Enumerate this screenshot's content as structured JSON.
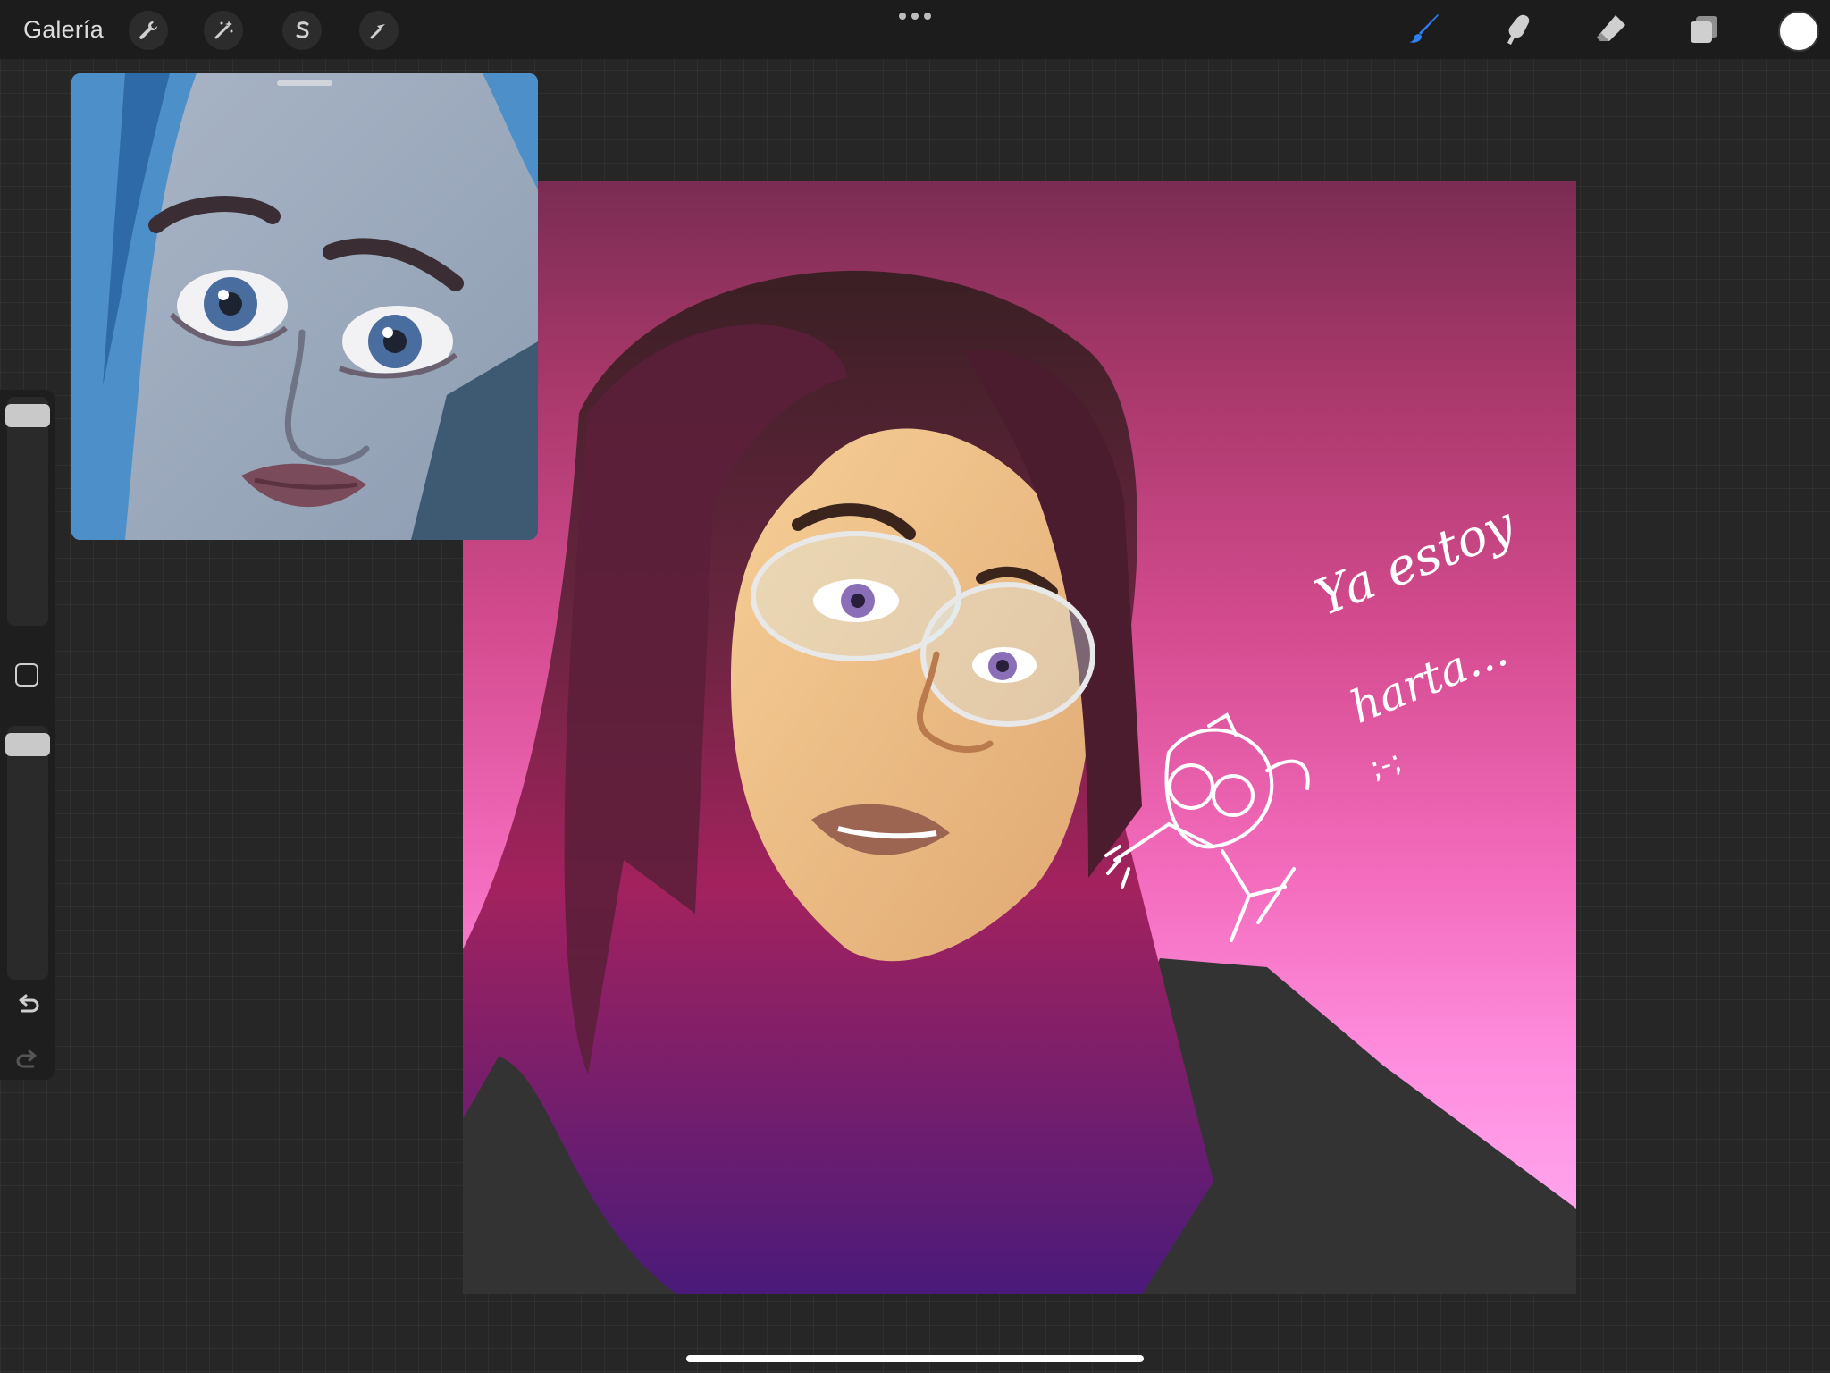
{
  "toolbar": {
    "gallery_label": "Galería",
    "left_tools": [
      {
        "name": "actions",
        "icon": "wrench-icon"
      },
      {
        "name": "adjustments",
        "icon": "magic-wand-icon"
      },
      {
        "name": "selection",
        "icon": "selection-s-icon"
      },
      {
        "name": "transform",
        "icon": "arrow-cursor-icon"
      }
    ],
    "more_icon": "more-dots-icon",
    "right_tools": [
      {
        "name": "brush",
        "icon": "brush-icon",
        "active": true
      },
      {
        "name": "smudge",
        "icon": "smudge-finger-icon"
      },
      {
        "name": "eraser",
        "icon": "eraser-icon"
      },
      {
        "name": "layers",
        "icon": "layers-icon"
      }
    ],
    "current_color": "#ffffff",
    "active_color": "#2f7ff5"
  },
  "reference": {
    "content": "reference-photo"
  },
  "canvas": {
    "sketch_text_line1": "Ya estoy",
    "sketch_text_line2": "harta...",
    "sketch_text_line3": ";-;",
    "background_colors": [
      "#7a2c52",
      "#d44b8f",
      "#ff8fe0",
      "#ffb0f4"
    ]
  },
  "sidebar": {
    "brush_size_icon": "brush-size-slider",
    "modify_icon": "square-modify-icon",
    "opacity_icon": "opacity-slider",
    "undo_icon": "undo-arrow-icon",
    "redo_icon": "redo-arrow-icon"
  }
}
